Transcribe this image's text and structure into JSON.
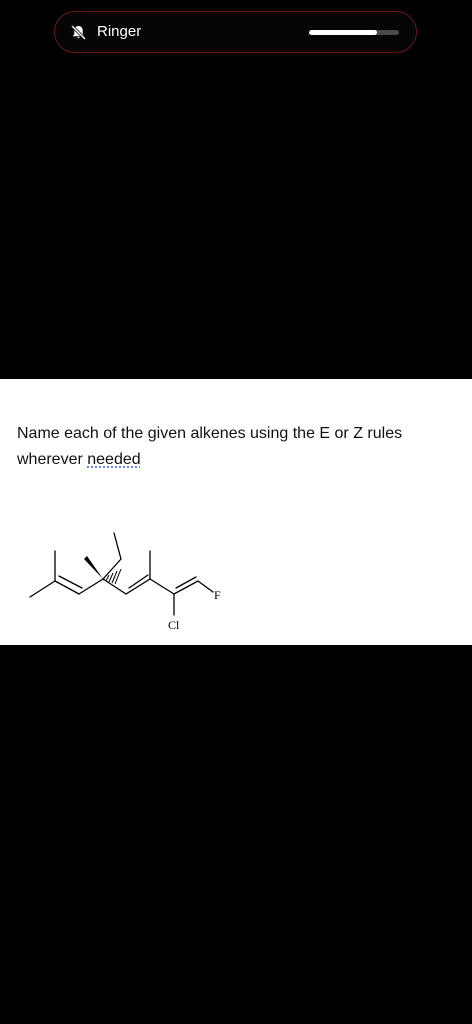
{
  "status_overlay": {
    "ringer_label": "Ringer",
    "icon": "bell-slash-icon",
    "volume_level_percent": 75
  },
  "question": {
    "text_before_link": "Name each of the given alkenes using the E or Z rules wherever ",
    "link_text": "needed"
  },
  "molecule": {
    "atom_labels": {
      "chlorine": "Cl",
      "fluorine": "F"
    }
  },
  "colors": {
    "background": "#000000",
    "card": "#ffffff",
    "pill_border": "#6b1a12",
    "link_underline": "#2b63d9"
  }
}
